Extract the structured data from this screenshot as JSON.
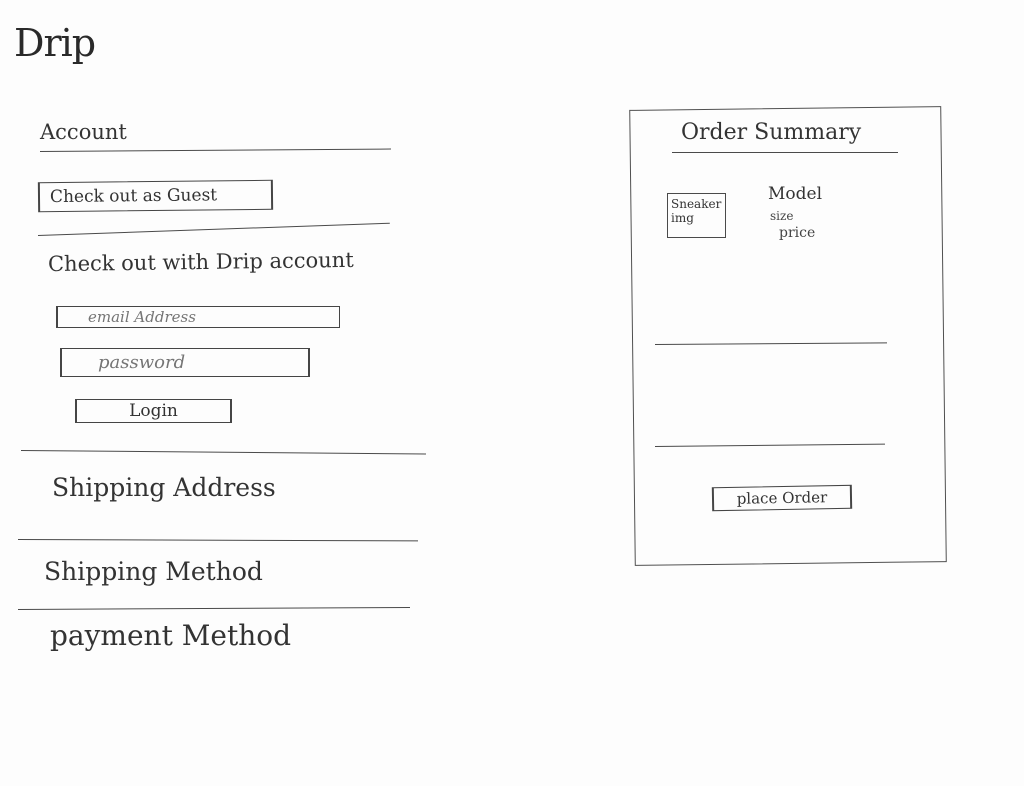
{
  "app": {
    "logo": "Drip"
  },
  "account": {
    "title": "Account",
    "guest_button": "Check out as Guest",
    "drip_account_title": "Check out with Drip account",
    "email_placeholder": "email Address",
    "password_placeholder": "password",
    "login_button": "Login"
  },
  "sections": {
    "shipping_address": "Shipping Address",
    "shipping_method": "Shipping Method",
    "payment_method": "payment Method"
  },
  "order_summary": {
    "title": "Order Summary",
    "item": {
      "image_label": "Sneaker img",
      "model": "Model",
      "size": "size",
      "price": "price"
    },
    "place_order_button": "place Order"
  }
}
